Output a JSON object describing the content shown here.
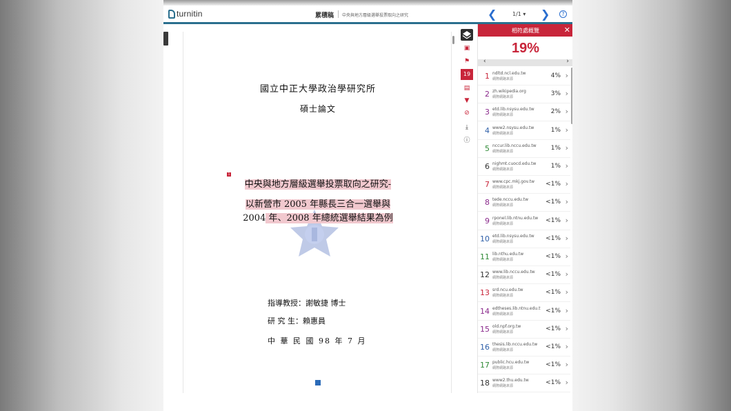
{
  "topbar": {
    "logo": "turnitin",
    "doc_title": "累積稿",
    "doc_subtitle": "中央與地方層級選舉投票取向之研究",
    "page_count": "1/1",
    "page_dropdown": "▾"
  },
  "document": {
    "line1": "國立中正大學政治學研究所",
    "line2": "碩士論文",
    "line3": "中央與地方層級選舉投票取向之研究-",
    "line4": "以新營市 2005 年縣長三合一選舉與",
    "line5_a": "2004",
    "line5_b": " 年、2008 年總統選舉結果為例",
    "marker": "1",
    "advisor": "指導教授：謝敏捷 博士",
    "student": "研 究 生：賴惠員",
    "date": "中 華 民 國 98 年 7 月"
  },
  "toolbar": {
    "match_count": "19"
  },
  "panel": {
    "title": "相符處概覽",
    "similarity": "19%",
    "sources": [
      {
        "num": "1",
        "name": "ndltd.ncl.edu.tw",
        "type": "網際網路來源",
        "pct": "4%",
        "color": "#c8253a"
      },
      {
        "num": "2",
        "name": "zh.wikipedia.org",
        "type": "網際網路來源",
        "pct": "3%",
        "color": "#8a2a8c"
      },
      {
        "num": "3",
        "name": "etd.lib.nsysu.edu.tw",
        "type": "網際網路來源",
        "pct": "2%",
        "color": "#8a2a8c"
      },
      {
        "num": "4",
        "name": "www2.nsysu.edu.tw",
        "type": "網際網路來源",
        "pct": "1%",
        "color": "#2e5fa8"
      },
      {
        "num": "5",
        "name": "nccur.lib.nccu.edu.tw",
        "type": "網際網路來源",
        "pct": "1%",
        "color": "#2f8a36"
      },
      {
        "num": "6",
        "name": "nighmt.cuocd.edu.tw",
        "type": "網際網路來源",
        "pct": "1%",
        "color": "#333333"
      },
      {
        "num": "7",
        "name": "www.cpc.mkj.gov.tw",
        "type": "網際網路來源",
        "pct": "<1%",
        "color": "#c8253a"
      },
      {
        "num": "8",
        "name": "tede.nccu.edu.tw",
        "type": "網際網路來源",
        "pct": "<1%",
        "color": "#8a2a8c"
      },
      {
        "num": "9",
        "name": "rponel.lib.ntnu.edu.tw",
        "type": "網際網路來源",
        "pct": "<1%",
        "color": "#8a2a8c"
      },
      {
        "num": "10",
        "name": "etd.lib.nsysu.edu.tw",
        "type": "網際網路來源",
        "pct": "<1%",
        "color": "#2e5fa8"
      },
      {
        "num": "11",
        "name": "lib.nthu.edu.tw",
        "type": "網際網路來源",
        "pct": "<1%",
        "color": "#2f8a36"
      },
      {
        "num": "12",
        "name": "www.lib.nccu.edu.tw",
        "type": "網際網路來源",
        "pct": "<1%",
        "color": "#333333"
      },
      {
        "num": "13",
        "name": "srd.ncu.edu.tw",
        "type": "網際網路來源",
        "pct": "<1%",
        "color": "#c8253a"
      },
      {
        "num": "14",
        "name": "edtheses.lib.ntnu.edu.tw",
        "type": "網際網路來源",
        "pct": "<1%",
        "color": "#8a2a8c"
      },
      {
        "num": "15",
        "name": "old.npf.org.tw",
        "type": "網際網路來源",
        "pct": "<1%",
        "color": "#8a2a8c"
      },
      {
        "num": "16",
        "name": "thesis.lib.nccu.edu.tw",
        "type": "網際網路來源",
        "pct": "<1%",
        "color": "#2e5fa8"
      },
      {
        "num": "17",
        "name": "public.hcu.edu.tw",
        "type": "網際網路來源",
        "pct": "<1%",
        "color": "#2f8a36"
      },
      {
        "num": "18",
        "name": "www2.thu.edu.tw",
        "type": "網際網路來源",
        "pct": "<1%",
        "color": "#333333"
      }
    ]
  }
}
